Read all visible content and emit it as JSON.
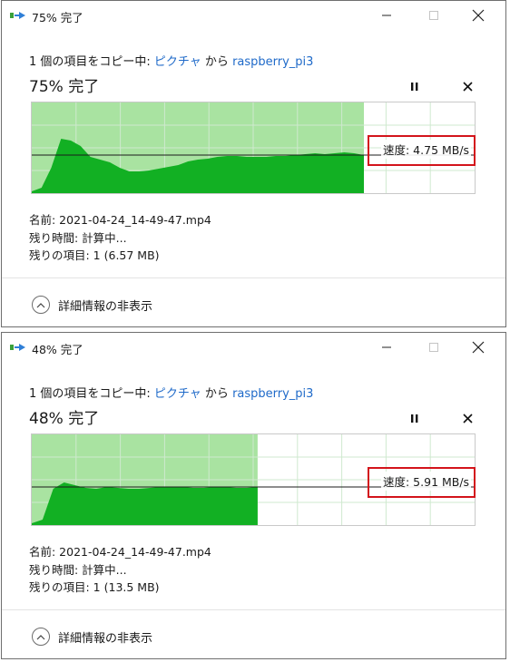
{
  "colors": {
    "graph_fill_completed": "#a9e3a1",
    "graph_speed_fill": "#12b023",
    "graph_grid": "#cfe9cf",
    "link": "#1f6ac9",
    "highlight_box": "#d3141b"
  },
  "dialogs": [
    {
      "window_title": "75% 完了",
      "source": {
        "prefix": "1 個の項目をコピー中: ",
        "from": "ピクチャ",
        "connector": " から ",
        "to": "raspberry_pi3"
      },
      "progress_title": "75% 完了",
      "progress_fraction": 0.75,
      "speed_label": "速度: 4.75 MB/s",
      "speed_profile": [
        0.02,
        0.06,
        0.28,
        0.6,
        0.58,
        0.52,
        0.4,
        0.37,
        0.34,
        0.28,
        0.24,
        0.24,
        0.25,
        0.27,
        0.29,
        0.31,
        0.35,
        0.37,
        0.38,
        0.4,
        0.41,
        0.41,
        0.4,
        0.4,
        0.4,
        0.41,
        0.41,
        0.42,
        0.43,
        0.44,
        0.43,
        0.44,
        0.45,
        0.44,
        0.42
      ],
      "details": {
        "name": "名前: 2021-04-24_14-49-47.mp4",
        "time_remaining": "残り時間: 計算中...",
        "items_remaining": "残りの項目: 1 (6.57 MB)"
      },
      "toggle_label": "詳細情報の非表示"
    },
    {
      "window_title": "48% 完了",
      "source": {
        "prefix": "1 個の項目をコピー中: ",
        "from": "ピクチャ",
        "connector": " から ",
        "to": "raspberry_pi3"
      },
      "progress_title": "48% 完了",
      "progress_fraction": 0.51,
      "speed_label": "速度: 5.91 MB/s",
      "speed_profile": [
        0.02,
        0.06,
        0.4,
        0.47,
        0.44,
        0.41,
        0.4,
        0.42,
        0.41,
        0.4,
        0.4,
        0.41,
        0.42,
        0.42,
        0.42,
        0.41,
        0.41,
        0.42,
        0.42,
        0.41,
        0.41,
        0.42
      ],
      "details": {
        "name": "名前: 2021-04-24_14-49-47.mp4",
        "time_remaining": "残り時間: 計算中...",
        "items_remaining": "残りの項目: 1 (13.5 MB)"
      },
      "toggle_label": "詳細情報の非表示"
    }
  ]
}
